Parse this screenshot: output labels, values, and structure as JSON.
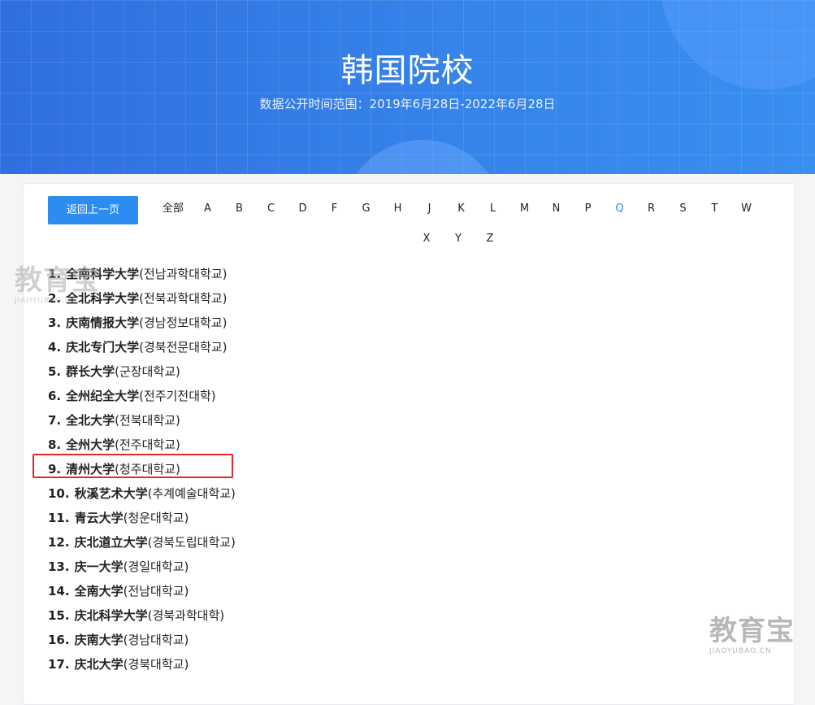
{
  "header": {
    "title": "韩国院校",
    "subtitle": "数据公开时间范围：2019年6月28日-2022年6月28日"
  },
  "toolbar": {
    "back_label": "返回上一页"
  },
  "filters": [
    {
      "label": "全部",
      "active": false
    },
    {
      "label": "A",
      "active": false
    },
    {
      "label": "B",
      "active": false
    },
    {
      "label": "C",
      "active": false
    },
    {
      "label": "D",
      "active": false
    },
    {
      "label": "F",
      "active": false
    },
    {
      "label": "G",
      "active": false
    },
    {
      "label": "H",
      "active": false
    },
    {
      "label": "J",
      "active": false
    },
    {
      "label": "K",
      "active": false
    },
    {
      "label": "L",
      "active": false
    },
    {
      "label": "M",
      "active": false
    },
    {
      "label": "N",
      "active": false
    },
    {
      "label": "P",
      "active": false
    },
    {
      "label": "Q",
      "active": true
    },
    {
      "label": "R",
      "active": false
    },
    {
      "label": "S",
      "active": false
    },
    {
      "label": "T",
      "active": false
    },
    {
      "label": "W",
      "active": false
    },
    {
      "label": "X",
      "active": false
    },
    {
      "label": "Y",
      "active": false
    },
    {
      "label": "Z",
      "active": false
    }
  ],
  "schools": [
    {
      "num": "1.",
      "zh": "全南科学大学",
      "ko": "(전남과학대학교)"
    },
    {
      "num": "2.",
      "zh": "全北科学大学",
      "ko": "(전북과학대학교)"
    },
    {
      "num": "3.",
      "zh": "庆南情报大学",
      "ko": "(경남정보대학교)"
    },
    {
      "num": "4.",
      "zh": "庆北专门大学",
      "ko": "(경북전문대학교)"
    },
    {
      "num": "5.",
      "zh": "群长大学",
      "ko": "(군장대학교)"
    },
    {
      "num": "6.",
      "zh": "全州纪全大学",
      "ko": "(전주기전대학)"
    },
    {
      "num": "7.",
      "zh": "全北大学",
      "ko": "(전북대학교)"
    },
    {
      "num": "8.",
      "zh": "全州大学",
      "ko": "(전주대학교)"
    },
    {
      "num": "9.",
      "zh": "清州大学",
      "ko": "(청주대학교)"
    },
    {
      "num": "10.",
      "zh": "秋溪艺术大学",
      "ko": "(추계예술대학교)"
    },
    {
      "num": "11.",
      "zh": "青云大学",
      "ko": "(청운대학교)"
    },
    {
      "num": "12.",
      "zh": "庆北道立大学",
      "ko": "(경북도립대학교)"
    },
    {
      "num": "13.",
      "zh": "庆一大学",
      "ko": "(경일대학교)"
    },
    {
      "num": "14.",
      "zh": "全南大学",
      "ko": "(전남대학교)"
    },
    {
      "num": "15.",
      "zh": "庆北科学大学",
      "ko": "(경북과학대학)"
    },
    {
      "num": "16.",
      "zh": "庆南大学",
      "ko": "(경남대학교)"
    },
    {
      "num": "17.",
      "zh": "庆北大学",
      "ko": "(경북대학교)"
    }
  ],
  "watermark": {
    "brand": "教育宝",
    "domain": "JIAOYUBAO.CN"
  },
  "colors": {
    "accent": "#2d8cf0",
    "highlight": "#e5282a",
    "banner_start": "#2f6fdf",
    "banner_end": "#3a8ef0"
  }
}
